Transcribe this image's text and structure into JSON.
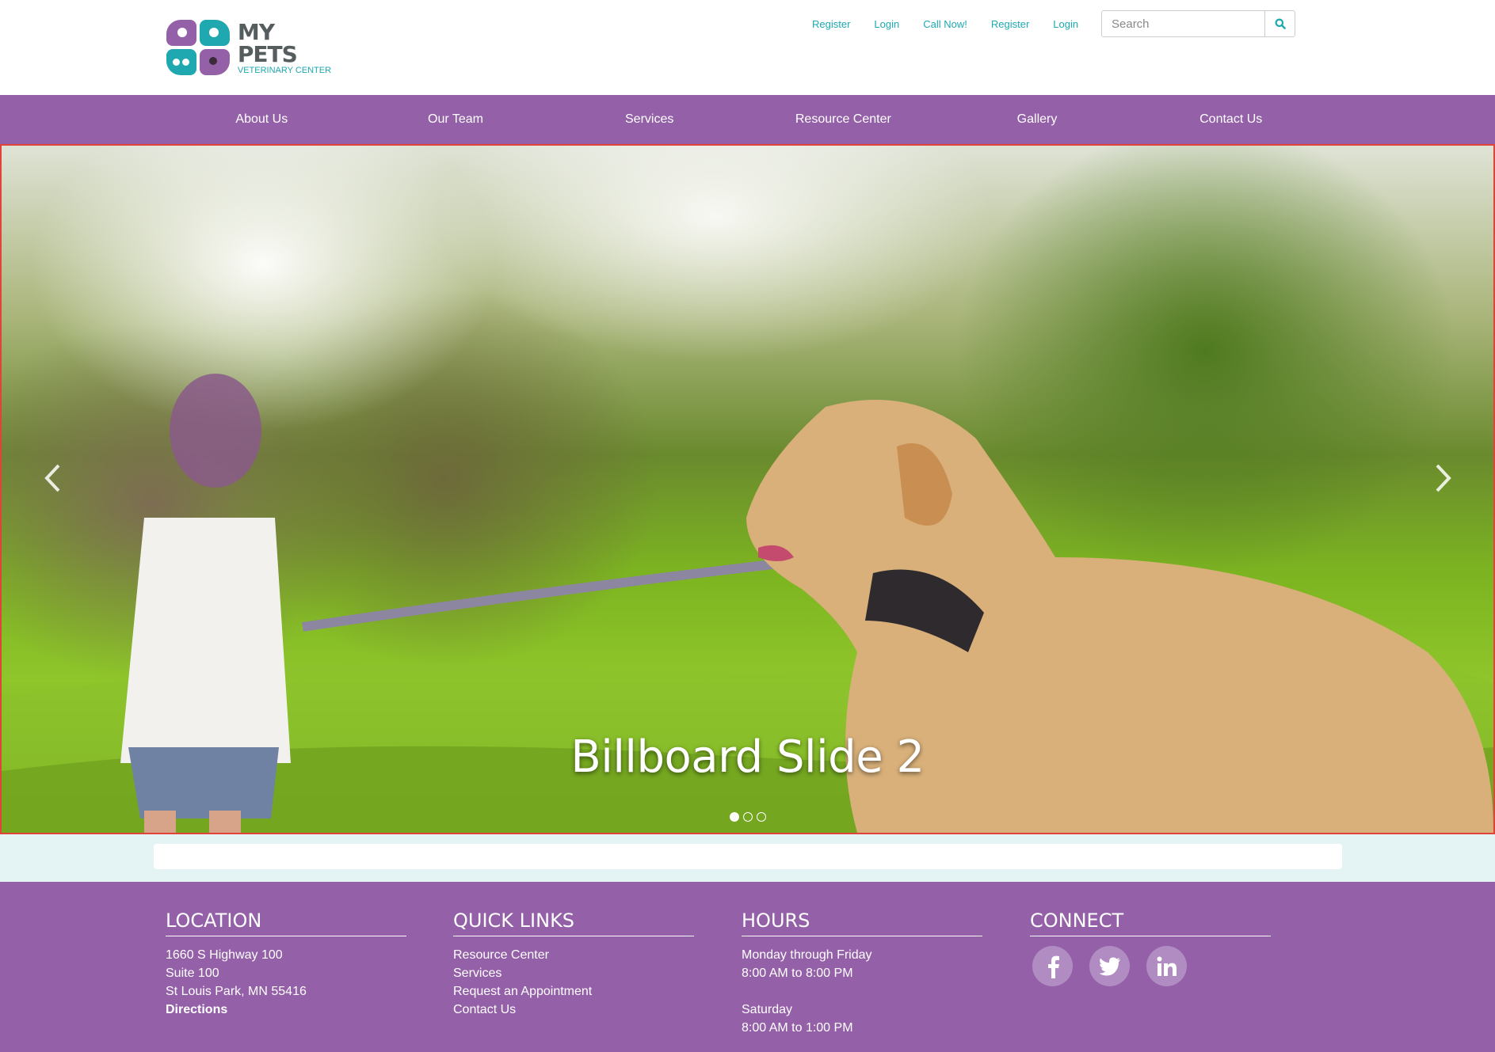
{
  "brand": {
    "name": "MY PETS",
    "tagline": "VETERINARY CENTER"
  },
  "top_links": [
    "Register",
    "Login",
    "Call Now!",
    "Register",
    "Login"
  ],
  "search": {
    "placeholder": "Search"
  },
  "nav": {
    "items": [
      "About Us",
      "Our Team",
      "Services",
      "Resource Center",
      "Gallery",
      "Contact Us"
    ]
  },
  "billboard": {
    "caption": "Billboard Slide 2",
    "slide_count": 3,
    "active_slide": 1
  },
  "footer": {
    "location": {
      "heading": "LOCATION",
      "lines": [
        "1660 S Highway 100",
        "Suite 100",
        "St Louis Park, MN 55416"
      ],
      "directions": "Directions"
    },
    "quick_links": {
      "heading": "QUICK LINKS",
      "links": [
        "Resource Center",
        "Services",
        "Request an Appointment",
        "Contact Us"
      ]
    },
    "hours": {
      "heading": "HOURS",
      "weekday_label": "Monday through Friday",
      "weekday_hours": "8:00 AM to 8:00 PM",
      "saturday_label": "Saturday",
      "saturday_hours": "8:00 AM to 1:00 PM"
    },
    "connect": {
      "heading": "CONNECT",
      "icons": [
        "facebook-icon",
        "twitter-icon",
        "linkedin-icon"
      ]
    }
  },
  "colors": {
    "brand_purple": "#9460a8",
    "brand_teal": "#1fa8b0",
    "band_light": "#e4f3f4",
    "slide_border": "#e0433a"
  }
}
